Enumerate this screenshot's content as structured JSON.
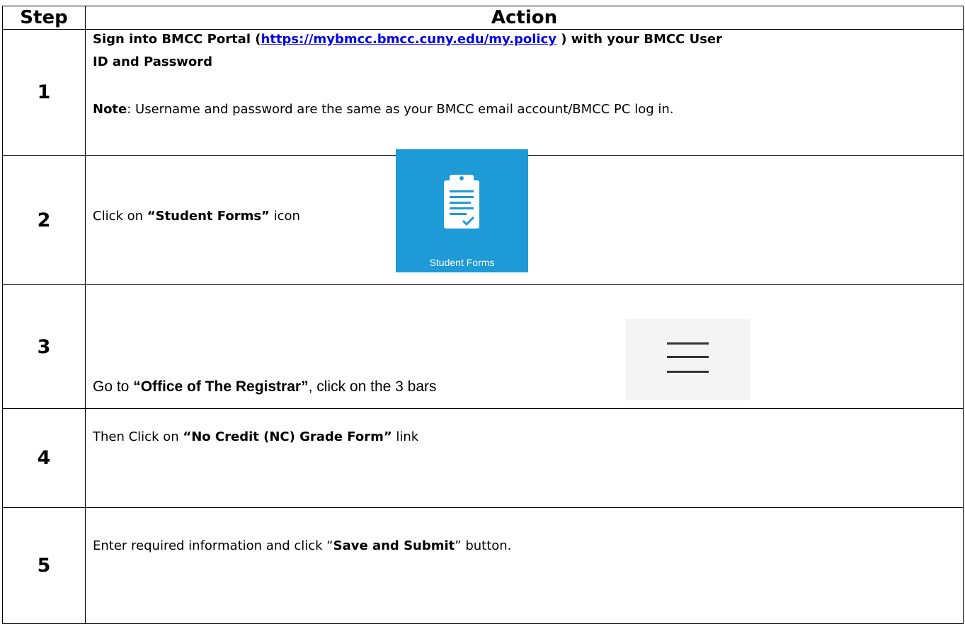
{
  "table": {
    "headers": [
      "Step",
      "Action"
    ],
    "steps": [
      {
        "number": "1",
        "line1_part1": "Sign into BMCC Portal (",
        "link_text": "https://mybmcc.bmcc.cuny.edu/my.policy",
        "line1_part2": " ) with your BMCC User",
        "line2": "ID and Password",
        "note_label": "Note",
        "note_text": ": Username and password are the same as your BMCC email account/BMCC PC log in."
      },
      {
        "number": "2",
        "text_prefix": "Click on ",
        "text_bold": "“Student Forms”",
        "text_suffix": " icon",
        "tile_label": "Student Forms",
        "tile_color": "#1e9ad6"
      },
      {
        "number": "3",
        "text_prefix": "Go to ",
        "text_bold": "“Office of The Registrar”",
        "text_suffix": ", click on the 3 bars",
        "menu_icon": "hamburger-menu-icon"
      },
      {
        "number": "4",
        "text_prefix": "Then Click on ",
        "text_bold": "“No Credit (NC) Grade Form”",
        "text_suffix": " link"
      },
      {
        "number": "5",
        "text_prefix": "Enter required information and click “",
        "text_bold": "Save and Submit",
        "text_suffix": "” button."
      }
    ]
  }
}
